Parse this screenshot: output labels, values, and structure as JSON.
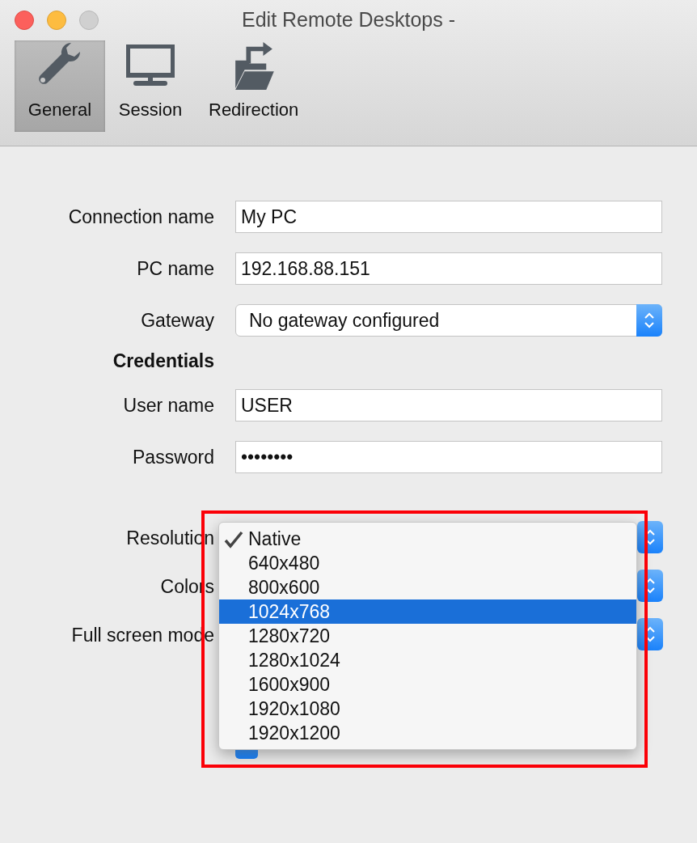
{
  "window": {
    "title": "Edit Remote Desktops -"
  },
  "toolbar": [
    {
      "label": "General",
      "kind": "wrench",
      "selected": true
    },
    {
      "label": "Session",
      "kind": "monitor",
      "selected": false
    },
    {
      "label": "Redirection",
      "kind": "folder",
      "selected": false
    }
  ],
  "fields": [
    {
      "kind": "text",
      "label": "Connection name",
      "value": "My PC"
    },
    {
      "kind": "text",
      "label": "PC name",
      "value": "192.168.88.151"
    },
    {
      "kind": "select",
      "label": "Gateway",
      "value": "No gateway configured"
    },
    {
      "kind": "heading",
      "label": "Credentials"
    },
    {
      "kind": "text",
      "label": "User name",
      "value": "USER"
    },
    {
      "kind": "text",
      "label": "Password",
      "value": "••••••••"
    }
  ],
  "display": [
    {
      "label": "Resolution"
    },
    {
      "label": "Colors"
    },
    {
      "label": "Full screen mode"
    }
  ],
  "checkboxes": [
    {
      "checked": true
    }
  ],
  "resolution_menu": {
    "items": [
      {
        "label": "Native",
        "checked": true,
        "selected": false
      },
      {
        "label": "640x480",
        "checked": false,
        "selected": false
      },
      {
        "label": "800x600",
        "checked": false,
        "selected": false
      },
      {
        "label": "1024x768",
        "checked": false,
        "selected": true
      },
      {
        "label": "1280x720",
        "checked": false,
        "selected": false
      },
      {
        "label": "1280x1024",
        "checked": false,
        "selected": false
      },
      {
        "label": "1600x900",
        "checked": false,
        "selected": false
      },
      {
        "label": "1920x1080",
        "checked": false,
        "selected": false
      },
      {
        "label": "1920x1200",
        "checked": false,
        "selected": false
      }
    ]
  }
}
